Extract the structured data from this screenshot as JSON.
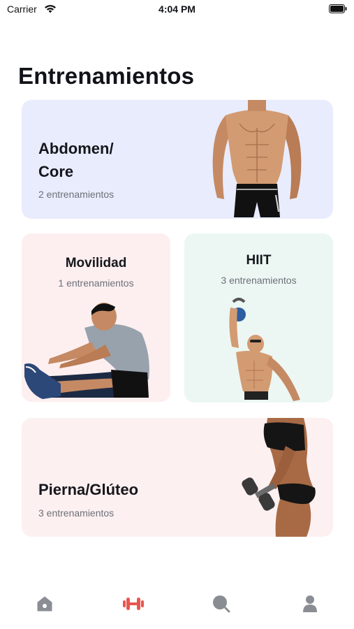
{
  "status_bar": {
    "carrier": "Carrier",
    "time": "4:04 PM",
    "icons": [
      "wifi-icon",
      "battery-icon"
    ]
  },
  "page": {
    "title": "Entrenamientos"
  },
  "categories": [
    {
      "title": "Abdomen/ Core",
      "subtitle": "2 entrenamientos",
      "background": "#e9ecfd",
      "image": "abdomen-athlete-photo"
    },
    {
      "title": "Movilidad",
      "subtitle": "1 entrenamientos",
      "background": "#fdeff0",
      "image": "stretching-man-photo"
    },
    {
      "title": "HIIT",
      "subtitle": "3 entrenamientos",
      "background": "#ecf7f3",
      "image": "kettlebell-man-photo"
    },
    {
      "title": "Pierna/Glúteo",
      "subtitle": "3 entrenamientos",
      "background": "#fdf0f1",
      "image": "dumbbell-woman-photo"
    }
  ],
  "tab_bar": {
    "items": [
      {
        "icon": "home-icon",
        "active": false
      },
      {
        "icon": "dumbbell-icon",
        "active": true
      },
      {
        "icon": "search-icon",
        "active": false
      },
      {
        "icon": "profile-icon",
        "active": false
      }
    ],
    "active_color": "#e8574f",
    "inactive_color": "#8a8d94"
  }
}
